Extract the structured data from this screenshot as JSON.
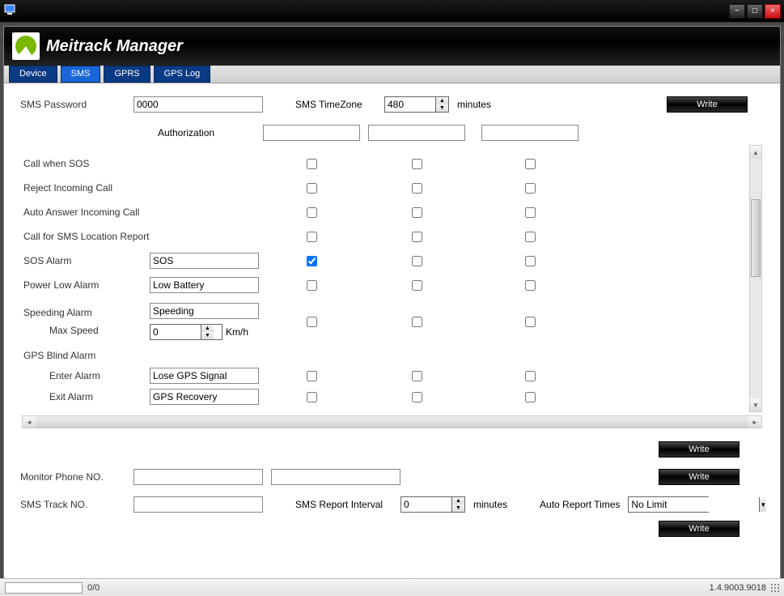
{
  "window": {
    "app_icon": "monitor",
    "min": "−",
    "max": "□",
    "close": "×"
  },
  "header": {
    "title": "Meitrack Manager"
  },
  "tabs": [
    "Device",
    "SMS",
    "GPRS",
    "GPS Log"
  ],
  "top": {
    "sms_password_label": "SMS Password",
    "sms_password_value": "0000",
    "tz_label": "SMS TimeZone",
    "tz_value": "480",
    "tz_unit": "minutes",
    "write": "Write",
    "authorization_label": "Authorization",
    "auth1": "",
    "auth2": "",
    "auth3": ""
  },
  "grid": {
    "rows": [
      {
        "label": "Call when SOS",
        "input": null,
        "c": [
          false,
          false,
          false
        ]
      },
      {
        "label": "Reject Incoming Call",
        "input": null,
        "c": [
          false,
          false,
          false
        ]
      },
      {
        "label": "Auto Answer Incoming Call",
        "input": null,
        "c": [
          false,
          false,
          false
        ]
      },
      {
        "label": "Call for SMS Location Report",
        "input": null,
        "c": [
          false,
          false,
          false
        ]
      },
      {
        "label": "SOS Alarm",
        "input": "SOS",
        "c": [
          true,
          false,
          false
        ]
      },
      {
        "label": "Power Low Alarm",
        "input": "Low Battery",
        "c": [
          false,
          false,
          false
        ]
      }
    ],
    "speeding": {
      "label": "Speeding Alarm",
      "value": "Speeding",
      "max_speed_label": "Max Speed",
      "max_speed_value": "0",
      "unit": "Km/h",
      "c": [
        false,
        false,
        false
      ]
    },
    "gps_blind": {
      "label": "GPS Blind Alarm",
      "enter_label": "Enter Alarm",
      "enter_value": "Lose GPS Signal",
      "exit_label": "Exit Alarm",
      "exit_value": "GPS Recovery",
      "enter_c": [
        false,
        false,
        false
      ],
      "exit_c": [
        false,
        false,
        false
      ]
    }
  },
  "bottom": {
    "write": "Write",
    "monitor_label": "Monitor Phone NO.",
    "monitor1": "",
    "monitor2": "",
    "track_label": "SMS Track NO.",
    "track_value": "",
    "interval_label": "SMS Report Interval",
    "interval_value": "0",
    "interval_unit": "minutes",
    "auto_report_label": "Auto Report Times",
    "auto_report_value": "No Limit"
  },
  "status": {
    "progress_text": "0/0",
    "version": "1.4.9003.9018"
  }
}
